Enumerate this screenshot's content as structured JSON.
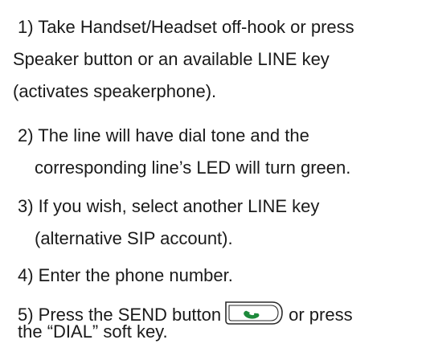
{
  "steps": [
    {
      "lines": [
        "1) Take Handset/Headset off-hook or press",
        "Speaker button or an available LINE key",
        "(activates speakerphone)."
      ]
    },
    {
      "lines": [
        "2) The line will have dial tone and the",
        "corresponding line’s LED will turn green."
      ]
    },
    {
      "lines": [
        "3) If you wish, select another LINE key",
        "(alternative SIP account)."
      ]
    },
    {
      "lines": [
        "4) Enter the phone number."
      ]
    },
    {
      "line1_before": "5) Press the SEND button",
      "line1_after": "or press",
      "line2": "the “DIAL” soft key."
    }
  ],
  "colors": {
    "text": "#1a1a1a",
    "send_icon": "#1e8a3c"
  },
  "icons": {
    "send": "send-handset-icon"
  }
}
